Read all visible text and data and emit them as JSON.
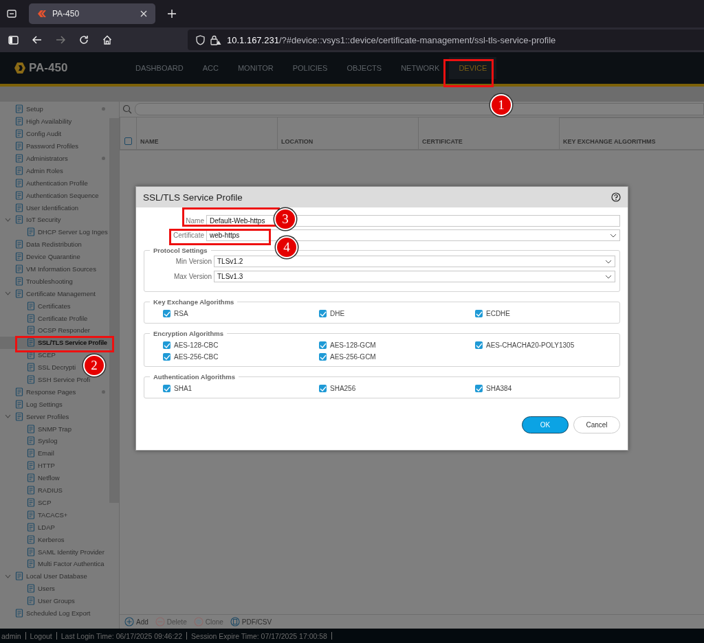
{
  "browser": {
    "tab_title": "PA-450",
    "url_host": "10.1.167.231",
    "url_path": "/?#device::vsys1::device/certificate-management/ssl-tls-service-profile"
  },
  "app": {
    "logo": "PA-450",
    "nav": [
      {
        "label": "DASHBOARD",
        "selected": false
      },
      {
        "label": "ACC",
        "selected": false
      },
      {
        "label": "MONITOR",
        "selected": false
      },
      {
        "label": "POLICIES",
        "selected": false
      },
      {
        "label": "OBJECTS",
        "selected": false
      },
      {
        "label": "NETWORK",
        "selected": false
      },
      {
        "label": "DEVICE",
        "selected": true
      }
    ]
  },
  "sidebar": {
    "items": [
      {
        "label": "Setup",
        "selected": false,
        "dot": true
      },
      {
        "label": "High Availability",
        "selected": false
      },
      {
        "label": "Config Audit",
        "selected": false
      },
      {
        "label": "Password Profiles",
        "selected": false
      },
      {
        "label": "Administrators",
        "selected": false,
        "dot": true
      },
      {
        "label": "Admin Roles",
        "selected": false
      },
      {
        "label": "Authentication Profile",
        "selected": false
      },
      {
        "label": "Authentication Sequence",
        "selected": false
      },
      {
        "label": "User Identification",
        "selected": false
      },
      {
        "label": "IoT Security",
        "selected": false,
        "expanded": true,
        "children": [
          {
            "label": "DHCP Server Log Inges",
            "selected": false
          }
        ]
      },
      {
        "label": "Data Redistribution",
        "selected": false
      },
      {
        "label": "Device Quarantine",
        "selected": false
      },
      {
        "label": "VM Information Sources",
        "selected": false
      },
      {
        "label": "Troubleshooting",
        "selected": false
      },
      {
        "label": "Certificate Management",
        "selected": false,
        "expanded": true,
        "children": [
          {
            "label": "Certificates",
            "selected": false
          },
          {
            "label": "Certificate Profile",
            "selected": false
          },
          {
            "label": "OCSP Responder",
            "selected": false
          },
          {
            "label": "SSL/TLS Service Profile",
            "selected": true
          },
          {
            "label": "SCEP",
            "selected": false
          },
          {
            "label": "SSL Decrypti",
            "selected": false
          },
          {
            "label": "SSH Service Profi",
            "selected": false
          }
        ]
      },
      {
        "label": "Response Pages",
        "selected": false,
        "dot": true
      },
      {
        "label": "Log Settings",
        "selected": false
      },
      {
        "label": "Server Profiles",
        "selected": false,
        "expanded": true,
        "children": [
          {
            "label": "SNMP Trap",
            "selected": false
          },
          {
            "label": "Syslog",
            "selected": false
          },
          {
            "label": "Email",
            "selected": false
          },
          {
            "label": "HTTP",
            "selected": false
          },
          {
            "label": "Netflow",
            "selected": false
          },
          {
            "label": "RADIUS",
            "selected": false
          },
          {
            "label": "SCP",
            "selected": false
          },
          {
            "label": "TACACS+",
            "selected": false
          },
          {
            "label": "LDAP",
            "selected": false
          },
          {
            "label": "Kerberos",
            "selected": false
          },
          {
            "label": "SAML Identity Provider",
            "selected": false
          },
          {
            "label": "Multi Factor Authentica",
            "selected": false
          }
        ]
      },
      {
        "label": "Local User Database",
        "selected": false,
        "expanded": true,
        "children": [
          {
            "label": "Users",
            "selected": false
          },
          {
            "label": "User Groups",
            "selected": false
          }
        ]
      },
      {
        "label": "Scheduled Log Export",
        "selected": false
      }
    ]
  },
  "table": {
    "select_all": {
      "checked": false
    },
    "columns": [
      "NAME",
      "LOCATION",
      "CERTIFICATE",
      "KEY EXCHANGE ALGORITHMS"
    ]
  },
  "toolbar": [
    {
      "label": "Add",
      "disabled": false
    },
    {
      "label": "Delete",
      "disabled": true
    },
    {
      "label": "Clone",
      "disabled": true
    },
    {
      "label": "PDF/CSV",
      "disabled": false
    }
  ],
  "status_bar": {
    "user": "admin",
    "logout": "Logout",
    "last_login": "Last Login Time: 06/17/2025 09:46:22",
    "session_expire": "Session Expire Time: 07/17/2025 17:00:58"
  },
  "dialog": {
    "title": "SSL/TLS Service Profile",
    "fields": [
      {
        "label": "Name",
        "kind": "text",
        "value": "Default-Web-https"
      },
      {
        "label": "Certificate",
        "kind": "select",
        "value": "web-https"
      }
    ],
    "protocol_settings": {
      "title": "Protocol Settings",
      "fields": [
        {
          "label": "Min Version",
          "value": "TLSv1.2"
        },
        {
          "label": "Max Version",
          "value": "TLSv1.3"
        }
      ]
    },
    "groups": [
      {
        "title": "Key Exchange Algorithms",
        "options": [
          {
            "label": "RSA",
            "checked": true
          },
          {
            "label": "DHE",
            "checked": true
          },
          {
            "label": "ECDHE",
            "checked": true
          }
        ]
      },
      {
        "title": "Encryption Algorithms",
        "options": [
          {
            "label": "AES-128-CBC",
            "checked": true
          },
          {
            "label": "AES-128-GCM",
            "checked": true
          },
          {
            "label": "AES-CHACHA20-POLY1305",
            "checked": true
          },
          {
            "label": "AES-256-CBC",
            "checked": true
          },
          {
            "label": "AES-256-GCM",
            "checked": true
          }
        ]
      },
      {
        "title": "Authentication Algorithms",
        "options": [
          {
            "label": "SHA1",
            "checked": true
          },
          {
            "label": "SHA256",
            "checked": true
          },
          {
            "label": "SHA384",
            "checked": true
          }
        ]
      }
    ],
    "buttons": [
      {
        "label": "OK",
        "kind": "primary"
      },
      {
        "label": "Cancel",
        "kind": "secondary"
      }
    ]
  },
  "annotations": [
    {
      "label": "1"
    },
    {
      "label": "2"
    },
    {
      "label": "3"
    },
    {
      "label": "4"
    }
  ]
}
